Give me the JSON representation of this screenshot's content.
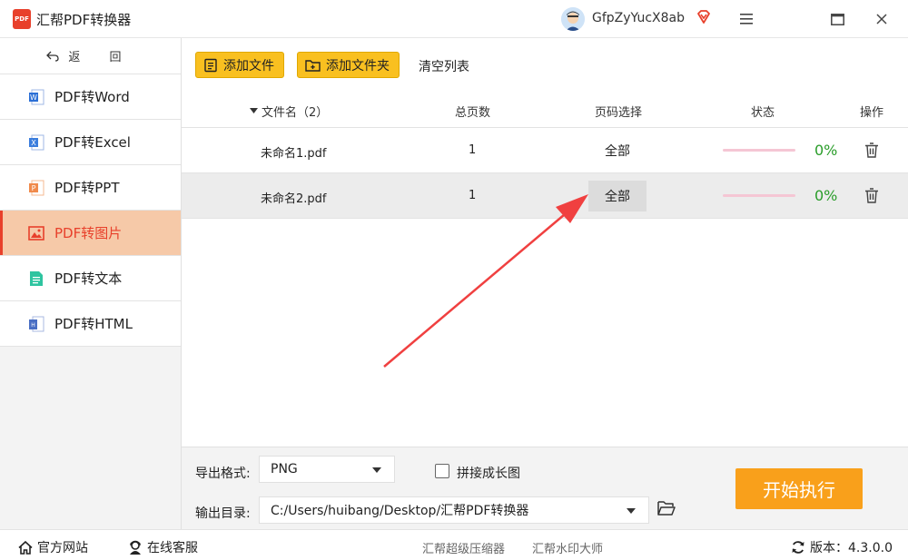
{
  "app": {
    "logo_text": "PDF",
    "title": "汇帮PDF转换器"
  },
  "user": {
    "name": "GfpZyYucX8ab"
  },
  "sidebar": {
    "back_label": "返 回",
    "items": [
      {
        "label": "PDF转Word",
        "icon": "word-icon",
        "color": "#2b6fd6"
      },
      {
        "label": "PDF转Excel",
        "icon": "excel-icon",
        "color": "#3b7ddd"
      },
      {
        "label": "PDF转PPT",
        "icon": "ppt-icon",
        "color": "#f08a4b"
      },
      {
        "label": "PDF转图片",
        "icon": "image-icon",
        "color": "#e8402b",
        "active": true
      },
      {
        "label": "PDF转文本",
        "icon": "text-icon",
        "color": "#2ec4a0"
      },
      {
        "label": "PDF转HTML",
        "icon": "html-icon",
        "color": "#4a6fc4"
      }
    ]
  },
  "toolbar": {
    "add_file": "添加文件",
    "add_folder": "添加文件夹",
    "clear_list": "清空列表"
  },
  "table": {
    "headers": {
      "name": "文件名（2）",
      "pages": "总页数",
      "page_select": "页码选择",
      "status": "状态",
      "action": "操作"
    },
    "rows": [
      {
        "name": "未命名1.pdf",
        "pages": "1",
        "page_select": "全部",
        "progress": 0,
        "percent": "0%"
      },
      {
        "name": "未命名2.pdf",
        "pages": "1",
        "page_select": "全部",
        "progress": 0,
        "percent": "0%",
        "selected": true
      }
    ]
  },
  "settings": {
    "format_label": "导出格式:",
    "format_value": "PNG",
    "merge_label": "拼接成长图",
    "output_label": "输出目录:",
    "output_value": "C:/Users/huibang/Desktop/汇帮PDF转换器",
    "start_label": "开始执行"
  },
  "statusbar": {
    "website": "官方网站",
    "support": "在线客服",
    "link1": "汇帮超级压缩器",
    "link2": "汇帮水印大师",
    "version": "版本：4.3.0.0"
  },
  "colors": {
    "accent": "#e8402b",
    "button_yellow": "#f9c020",
    "start_orange": "#f9a01b",
    "progress_green": "#2a9d2a",
    "active_bg": "#f6c9a8"
  }
}
